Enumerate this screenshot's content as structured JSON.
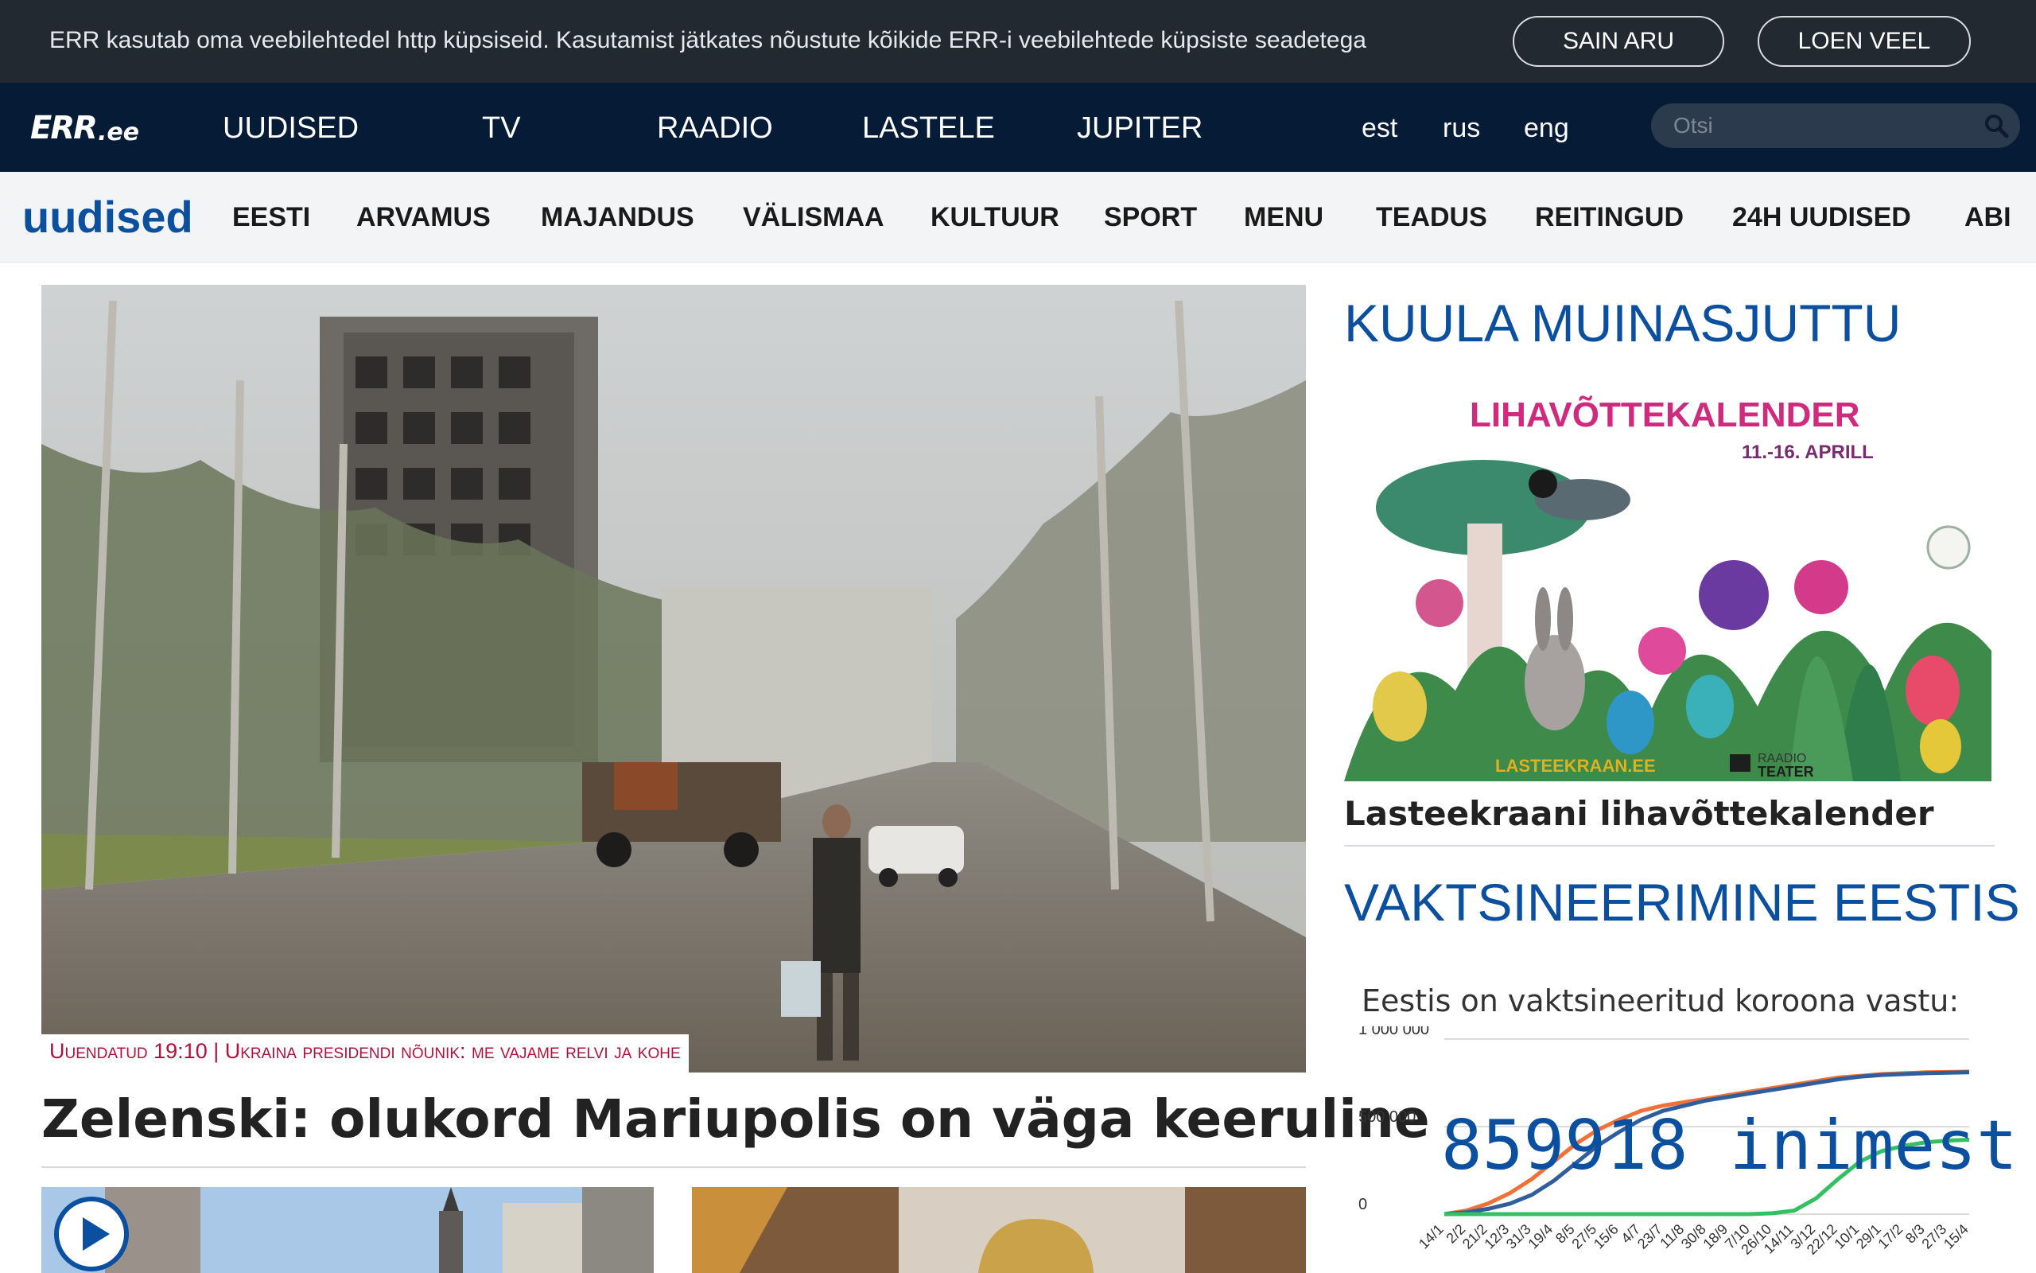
{
  "cookie_bar": {
    "text": "ERR kasutab oma veebilehtedel http küpsiseid. Kasutamist jätkates nõustute kõikide ERR-i veebilehtede küpsiste seadetega",
    "ok_label": "SAIN ARU",
    "more_label": "LOEN VEEL"
  },
  "topnav": {
    "logo_err": "ERR",
    "logo_ee": ".ee",
    "items": [
      "UUDISED",
      "TV",
      "RAADIO",
      "LASTELE",
      "JUPITER"
    ],
    "langs": [
      "est",
      "rus",
      "eng"
    ],
    "search_placeholder": "Otsi"
  },
  "subnav": {
    "section_title": "uudised",
    "items": [
      "EESTI",
      "ARVAMUS",
      "MAJANDUS",
      "VÄLISMAA",
      "KULTUUR",
      "SPORT",
      "MENU",
      "TEADUS",
      "REITINGUD",
      "24H UUDISED",
      "ABI"
    ]
  },
  "main": {
    "hero_label": "Uuendatud 19:10 | Ukraina presidendi nõunik: me vajame relvi ja kohe",
    "headline": "Zelenski: olukord Mariupolis on väga keeruline"
  },
  "sidebar": {
    "heading1": "KUULA MUINASJUTTU",
    "promo_title": "LIHAVÕTTEKALENDER",
    "promo_dates": "11.-16. APRILL",
    "promo_site": "LASTEEKRAAN.EE",
    "promo_partner_top": "RAADIO",
    "promo_partner_bottom": "TEATER",
    "caption": "Lasteekraani lihavõttekalender",
    "heading2": "VAKTSINEERIMINE EESTIS",
    "vax_label": "Eestis on vaktsineeritud koroona vastu:",
    "vax_count": "859918 inimest"
  },
  "chart_data": {
    "type": "line",
    "title": "",
    "ylim": [
      0,
      1000000
    ],
    "y_ticks": [
      "1 000 000",
      "500 000",
      "0"
    ],
    "x_ticks": [
      "14/1",
      "2/2",
      "21/2",
      "12/3",
      "31/3",
      "19/4",
      "8/5",
      "27/5",
      "15/6",
      "4/7",
      "23/7",
      "11/8",
      "30/8",
      "18/9",
      "7/10",
      "26/10",
      "14/11",
      "3/12",
      "22/12",
      "10/1",
      "29/1",
      "17/2",
      "8/3",
      "27/3",
      "15/4"
    ],
    "series": [
      {
        "color": "#f07038",
        "values": [
          0,
          20000,
          60000,
          120000,
          200000,
          300000,
          400000,
          480000,
          540000,
          590000,
          620000,
          640000,
          660000,
          680000,
          700000,
          720000,
          740000,
          760000,
          780000,
          790000,
          800000,
          805000,
          810000,
          812000,
          814000
        ]
      },
      {
        "color": "#2f5e9e",
        "values": [
          0,
          10000,
          30000,
          60000,
          110000,
          190000,
          290000,
          390000,
          470000,
          540000,
          590000,
          620000,
          650000,
          670000,
          690000,
          710000,
          730000,
          750000,
          770000,
          785000,
          795000,
          800000,
          805000,
          808000,
          810000
        ]
      },
      {
        "color": "#32c060",
        "values": [
          0,
          0,
          0,
          0,
          0,
          0,
          0,
          0,
          0,
          0,
          0,
          0,
          0,
          0,
          0,
          5000,
          20000,
          90000,
          200000,
          300000,
          360000,
          390000,
          410000,
          420000,
          425000
        ]
      }
    ]
  }
}
